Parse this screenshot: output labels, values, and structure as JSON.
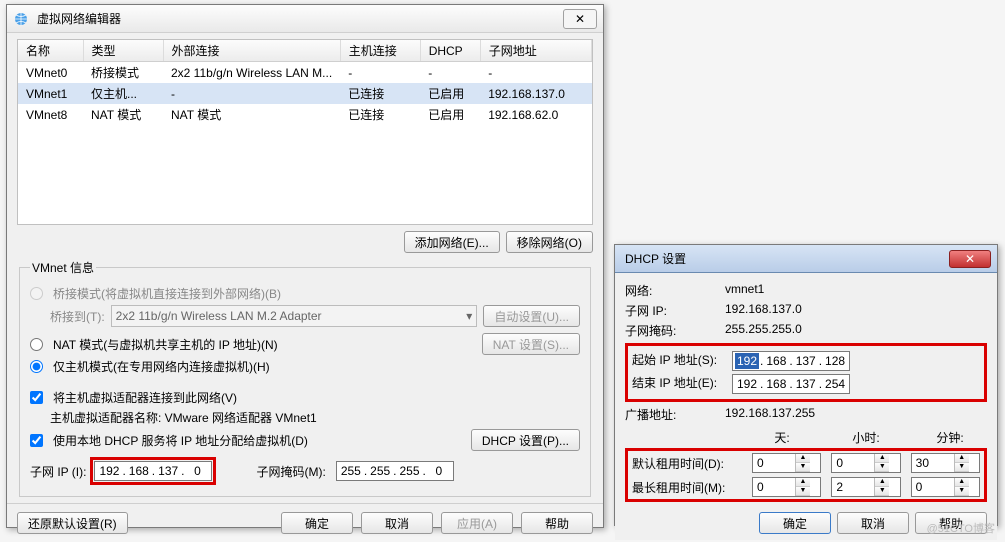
{
  "main": {
    "title": "虚拟网络编辑器",
    "close_glyph": "✕",
    "columns": {
      "c0": "名称",
      "c1": "类型",
      "c2": "外部连接",
      "c3": "主机连接",
      "c4": "DHCP",
      "c5": "子网地址"
    },
    "rows": [
      {
        "c0": "VMnet0",
        "c1": "桥接模式",
        "c2": "2x2 11b/g/n Wireless LAN M...",
        "c3": "-",
        "c4": "-",
        "c5": "-"
      },
      {
        "c0": "VMnet1",
        "c1": "仅主机...",
        "c2": "-",
        "c3": "已连接",
        "c4": "已启用",
        "c5": "192.168.137.0"
      },
      {
        "c0": "VMnet8",
        "c1": "NAT 模式",
        "c2": "NAT 模式",
        "c3": "已连接",
        "c4": "已启用",
        "c5": "192.168.62.0"
      }
    ],
    "btn_add": "添加网络(E)...",
    "btn_remove": "移除网络(O)",
    "fieldset_title": "VMnet 信息",
    "radio_bridge": "桥接模式(将虚拟机直接连接到外部网络)(B)",
    "bridge_to_label": "桥接到(T):",
    "bridge_to_value": "2x2 11b/g/n Wireless LAN M.2 Adapter",
    "btn_auto": "自动设置(U)...",
    "radio_nat": "NAT 模式(与虚拟机共享主机的 IP 地址)(N)",
    "btn_nat_setting": "NAT 设置(S)...",
    "radio_host": "仅主机模式(在专用网络内连接虚拟机)(H)",
    "check_connect_adapter": "将主机虚拟适配器连接到此网络(V)",
    "adapter_name_label": "主机虚拟适配器名称: VMware 网络适配器 VMnet1",
    "check_use_dhcp": "使用本地 DHCP 服务将 IP 地址分配给虚拟机(D)",
    "btn_dhcp_setting": "DHCP 设置(P)...",
    "subnet_ip_label": "子网 IP (I):",
    "subnet_ip": {
      "a": "192",
      "b": "168",
      "c": "137",
      "d": "0"
    },
    "subnet_mask_label": "子网掩码(M):",
    "subnet_mask": {
      "a": "255",
      "b": "255",
      "c": "255",
      "d": "0"
    },
    "btn_restore": "还原默认设置(R)",
    "btn_ok": "确定",
    "btn_cancel": "取消",
    "btn_apply": "应用(A)",
    "btn_help": "帮助"
  },
  "dhcp": {
    "title": "DHCP 设置",
    "close_glyph": "✕",
    "lbl_network": "网络:",
    "val_network": "vmnet1",
    "lbl_subnet_ip": "子网 IP:",
    "val_subnet_ip": "192.168.137.0",
    "lbl_subnet_mask": "子网掩码:",
    "val_subnet_mask": "255.255.255.0",
    "lbl_start_ip": "起始 IP 地址(S):",
    "start_ip": {
      "a": "192",
      "b": "168",
      "c": "137",
      "d": "128"
    },
    "lbl_end_ip": "结束 IP 地址(E):",
    "end_ip": {
      "a": "192",
      "b": "168",
      "c": "137",
      "d": "254"
    },
    "lbl_broadcast": "广播地址:",
    "val_broadcast": "192.168.137.255",
    "hdr_days": "天:",
    "hdr_hours": "小时:",
    "hdr_minutes": "分钟:",
    "lbl_default_lease": "默认租用时间(D):",
    "default_lease": {
      "d": "0",
      "h": "0",
      "m": "30"
    },
    "lbl_max_lease": "最长租用时间(M):",
    "max_lease": {
      "d": "0",
      "h": "2",
      "m": "0"
    },
    "btn_ok": "确定",
    "btn_cancel": "取消",
    "btn_help": "帮助"
  },
  "watermark": "@51CTO博客"
}
